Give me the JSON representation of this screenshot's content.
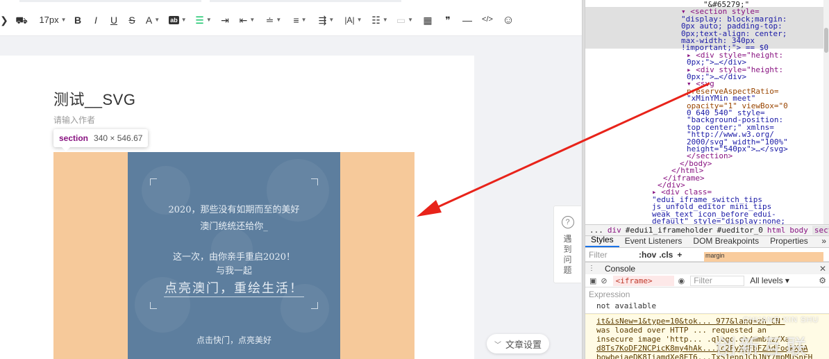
{
  "toolbar": {
    "font_size": "17px",
    "items": [
      {
        "name": "prev-arrow-icon",
        "glyph": "❯"
      },
      {
        "name": "format-painter-icon",
        "glyph": "⛟"
      },
      {
        "name": "bold-button",
        "glyph": "B"
      },
      {
        "name": "italic-button",
        "glyph": "I"
      },
      {
        "name": "underline-button",
        "glyph": "U"
      },
      {
        "name": "strikethrough-button",
        "glyph": "S"
      },
      {
        "name": "font-color-button",
        "glyph": "A"
      },
      {
        "name": "background-color-button",
        "glyph": "ab"
      },
      {
        "name": "align-left-button",
        "glyph": "☰"
      },
      {
        "name": "indent-button",
        "glyph": "⇥"
      },
      {
        "name": "outdent-button",
        "glyph": "⇤"
      },
      {
        "name": "line-height-button",
        "glyph": "≐"
      },
      {
        "name": "paragraph-spacing-button",
        "glyph": "≡"
      },
      {
        "name": "letter-spacing-button",
        "glyph": "|A|"
      },
      {
        "name": "list-button",
        "glyph": "☷"
      },
      {
        "name": "table-button",
        "glyph": "▦"
      },
      {
        "name": "quote-button",
        "glyph": "❞"
      },
      {
        "name": "hr-button",
        "glyph": "—"
      },
      {
        "name": "code-button",
        "glyph": "</>"
      },
      {
        "name": "emoji-button",
        "glyph": "☺"
      }
    ]
  },
  "article": {
    "title": "测试__SVG",
    "author_placeholder": "请输入作者"
  },
  "inspect_tooltip": {
    "tag": "section",
    "dims": "340 × 546.67"
  },
  "poster": {
    "line1": "2020，那些没有如期而至的美好",
    "line2": "澳门统统还给你_",
    "line3": "这一次，由你亲手重启2020！",
    "line4": "与我一起",
    "line5": "点亮澳门，重绘生活！",
    "line6": "点击快门，点亮美好"
  },
  "help_widget": {
    "q": "?",
    "text": "遇到问题"
  },
  "settings_button": {
    "label": "文章设置"
  },
  "devtools": {
    "dom_lines": [
      {
        "t": "txt",
        "s": "\"&#65279;\""
      },
      {
        "t": "mix",
        "s": "▾ <section style="
      },
      {
        "t": "val",
        "s": "\"display: block;margin:"
      },
      {
        "t": "val",
        "s": "0px auto; padding-top:"
      },
      {
        "t": "val",
        "s": "0px;text-align: center;"
      },
      {
        "t": "val",
        "s": "max-width: 340px"
      },
      {
        "t": "val",
        "s": "!important;\"> == $0"
      },
      {
        "t": "mix",
        "s": "▸ <div style=\"height:"
      },
      {
        "t": "val",
        "s": "0px;\">…</div>"
      },
      {
        "t": "mix",
        "s": "▸ <div style=\"height:"
      },
      {
        "t": "val",
        "s": "0px;\">…</div>"
      },
      {
        "t": "mix",
        "s": "▾ <svg"
      },
      {
        "t": "attr",
        "s": "preserveAspectRatio="
      },
      {
        "t": "val",
        "s": "\"xMinYMin meet\""
      },
      {
        "t": "attr",
        "s": "opacity=\"1\" viewBox=\"0"
      },
      {
        "t": "val",
        "s": "0 640 540\" style="
      },
      {
        "t": "val",
        "s": "\"background-position:"
      },
      {
        "t": "val",
        "s": "top center;\" xmlns="
      },
      {
        "t": "val",
        "s": "\"http://www.w3.org/"
      },
      {
        "t": "val",
        "s": "2000/svg\" width=\"100%\""
      },
      {
        "t": "val",
        "s": "height=\"540px\">…</svg>"
      },
      {
        "t": "tag",
        "s": "</section>"
      },
      {
        "t": "tag",
        "s": "</body>"
      },
      {
        "t": "tag",
        "s": "</html>"
      },
      {
        "t": "tag",
        "s": "</iframe>"
      },
      {
        "t": "tag",
        "s": "</div>"
      },
      {
        "t": "mix",
        "s": "▸ <div class="
      },
      {
        "t": "val",
        "s": "\"edui_iframe_switch_tips"
      },
      {
        "t": "val",
        "s": "js_unfold_editor mini_tips"
      },
      {
        "t": "val",
        "s": "weak_text icon_before edui-"
      },
      {
        "t": "val",
        "s": "default\" style=\"display:none;"
      },
      {
        "t": "val",
        "s": "\"> </div>"
      }
    ],
    "breadcrumbs": [
      "...",
      "div",
      "#edui1_iframeholder",
      "#ueditor_0",
      "html",
      "body",
      "section"
    ],
    "tabs": [
      "Styles",
      "Event Listeners",
      "DOM Breakpoints",
      "Properties"
    ],
    "tabs_more": "»",
    "styles_filter": "Filter",
    "hov": ":hov",
    "cls": ".cls",
    "plus": "+",
    "margin_label": "margin",
    "console_label": "Console",
    "console_context": "<iframe>",
    "console_filter": "Filter",
    "levels": "All levels ▾",
    "expression_label": "Expression",
    "expression_value": "not available",
    "warning_lines": [
      "it&isNew=1&type=10&tok... 977&lang=zh_CN'",
      "was loaded over HTTP ... requested an",
      "insecure image 'http... .qlogo.cn/mmbiz/Xa",
      "d8Ts7KoDF2NCPicK8my4hAk...1c2FyXdFbFZAdFookXGA",
      "bowbeiaeDK8IiamdXe8ET6...TxS1eppJCbJNY7mpMUSnFH"
    ]
  },
  "watermark": {
    "small": "CHUANG XIN SHU",
    "big": "创新互联"
  }
}
